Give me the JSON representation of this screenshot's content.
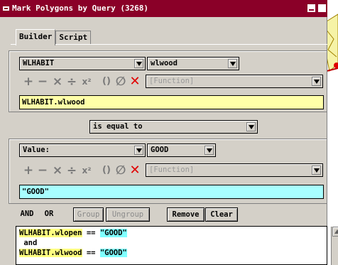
{
  "window": {
    "title": "Mark Polygons by Query (3268)"
  },
  "tabs": [
    {
      "label": "Builder",
      "active": true
    },
    {
      "label": "Script",
      "active": false
    }
  ],
  "builder": {
    "left": {
      "table_select": "WLHABIT",
      "field_select": "wlwood",
      "function_select": "[Function]",
      "expression": "WLHABIT.wlwood"
    },
    "comparison": "is equal to",
    "right": {
      "type_select": "Value:",
      "value_select": "GOOD",
      "function_select": "[Function]",
      "expression": "\"GOOD\""
    },
    "operators": [
      "+",
      "−",
      "×",
      "÷",
      "x²",
      "()",
      "∅",
      "✕",
      "document"
    ]
  },
  "actions": {
    "and": "AND",
    "or": "OR",
    "group": "Group",
    "ungroup": "Ungroup",
    "remove": "Remove",
    "clear": "Clear"
  },
  "query_lines": [
    {
      "field": "WLHABIT.wlopen",
      "op": " == ",
      "value": "\"GOOD\""
    },
    {
      "text": " and"
    },
    {
      "field": "WLHABIT.wlwood",
      "op": " == ",
      "value": "\"GOOD\""
    }
  ],
  "colors": {
    "titlebar": "#8a0028",
    "field_hl": "#ffff80",
    "value_hl": "#80ffff",
    "delete_red": "#e00000"
  }
}
